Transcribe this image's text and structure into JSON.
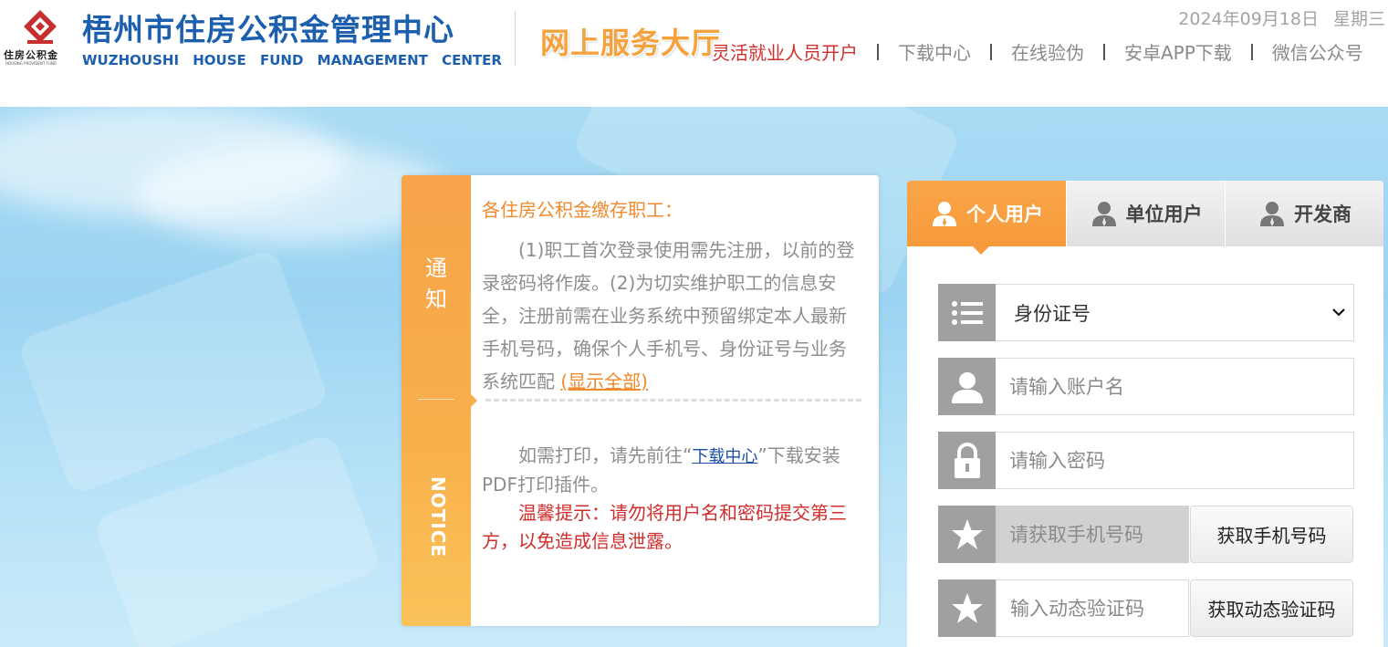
{
  "header": {
    "logo_small_text": "住房公积金",
    "logo_tiny_text": "HOUSING PROVIDENT FUND",
    "org_name": "梧州市住房公积金管理中心",
    "org_name_en": "WUZHOUSHI HOUSE FUND MANAGEMENT CENTER",
    "hall_title": "网上服务大厅",
    "date": "2024年09月18日",
    "weekday": "星期三",
    "nav": [
      {
        "label": "灵活就业人员开户"
      },
      {
        "label": "下载中心"
      },
      {
        "label": "在线验伪"
      },
      {
        "label": "安卓APP下载"
      },
      {
        "label": "微信公众号"
      }
    ]
  },
  "notice": {
    "label_zh_1": "通",
    "label_zh_2": "知",
    "label_en": "NOTICE",
    "heading": "各住房公积金缴存职工：",
    "body": "(1)职工首次登录使用需先注册，以前的登录密码将作废。(2)为切实维护职工的信息安全，注册前需在业务系统中预留绑定本人最新手机号码，确保个人手机号、身份证号与业务系统匹配",
    "show_all": "(显示全部)",
    "print_pre": "如需打印，请先前往“",
    "print_link": "下载中心",
    "print_post": "”下载安装PDF打印插件。",
    "warning": "温馨提示：请勿将用户名和密码提交第三方，以免造成信息泄露。"
  },
  "login": {
    "tabs": [
      {
        "label": "个人用户"
      },
      {
        "label": "单位用户"
      },
      {
        "label": "开发商"
      }
    ],
    "id_type_selected": "身份证号",
    "account_placeholder": "请输入账户名",
    "password_placeholder": "请输入密码",
    "phone_placeholder": "请获取手机号码",
    "get_phone_button": "获取手机号码",
    "code_placeholder": "输入动态验证码",
    "get_code_button": "获取动态验证码"
  },
  "colors": {
    "brand_blue": "#1b5fae",
    "accent_orange": "#f69a3a",
    "warning_red": "#d12d2d"
  },
  "icons": [
    "logo-diamond-icon",
    "user-icon",
    "list-icon",
    "lock-icon",
    "star-icon",
    "chevron-down-icon"
  ]
}
